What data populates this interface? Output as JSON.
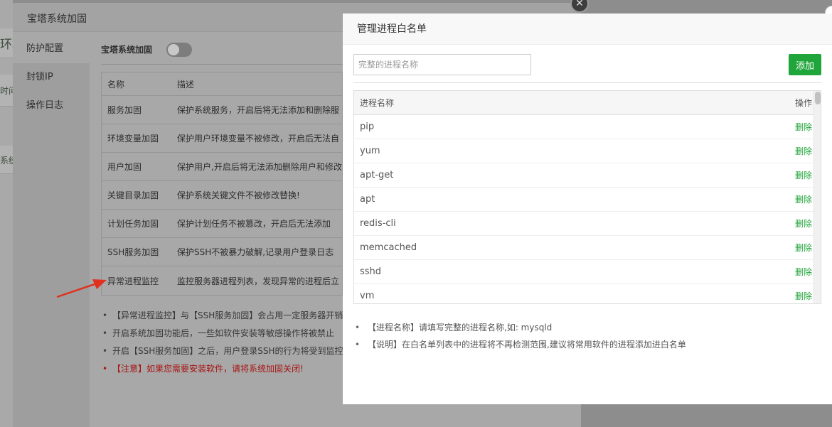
{
  "background_page": {
    "fragments": [
      "环境",
      "时间",
      "系统"
    ]
  },
  "back_dialog": {
    "title": "宝塔系统加固",
    "sidebar": [
      {
        "label": "防护配置",
        "active": true
      },
      {
        "label": "封锁IP",
        "active": false
      },
      {
        "label": "操作日志",
        "active": false
      }
    ],
    "toggle_label": "宝塔系统加固",
    "table": {
      "headers": [
        "名称",
        "描述"
      ],
      "rows": [
        {
          "name": "服务加固",
          "desc": "保护系统服务，开启后将无法添加和删除服"
        },
        {
          "name": "环境变量加固",
          "desc": "保护用户环境变量不被修改，开启后无法自"
        },
        {
          "name": "用户加固",
          "desc": "保护用户,开启后将无法添加删除用户和修改"
        },
        {
          "name": "关键目录加固",
          "desc": "保护系统关键文件不被修改替换!"
        },
        {
          "name": "计划任务加固",
          "desc": "保护计划任务不被篡改，开启后无法添加"
        },
        {
          "name": "SSH服务加固",
          "desc": "保护SSH不被暴力破解,记录用户登录日志"
        },
        {
          "name": "异常进程监控",
          "desc": "监控服务器进程列表，发现异常的进程后立"
        }
      ]
    },
    "notes": [
      {
        "text": "【异常进程监控】与【SSH服务加固】会占用一定服务器开销",
        "warn": false
      },
      {
        "text": "开启系统加固功能后，一些如软件安装等敏感操作将被禁止",
        "warn": false
      },
      {
        "text": "开启【SSH服务加固】之后，用户登录SSH的行为将受到监控",
        "warn": false
      },
      {
        "text": "【注意】如果您需要安装软件，请将系统加固关闭!",
        "warn": true
      }
    ]
  },
  "whitelist_dialog": {
    "title": "管理进程白名单",
    "input": {
      "value": "",
      "placeholder": "完整的进程名称"
    },
    "add_label": "添加",
    "table": {
      "headers": [
        "进程名称",
        "操作"
      ],
      "rows": [
        {
          "name": "pip",
          "action": "删除"
        },
        {
          "name": "yum",
          "action": "删除"
        },
        {
          "name": "apt-get",
          "action": "删除"
        },
        {
          "name": "apt",
          "action": "删除"
        },
        {
          "name": "redis-cli",
          "action": "删除"
        },
        {
          "name": "memcached",
          "action": "删除"
        },
        {
          "name": "sshd",
          "action": "删除"
        },
        {
          "name": "vm",
          "action": "删除"
        }
      ]
    },
    "notes": [
      "【进程名称】请填写完整的进程名称,如: mysqld",
      "【说明】在白名单列表中的进程将不再检测范围,建议将常用软件的进程添加进白名单"
    ]
  },
  "colors": {
    "accent_green": "#20a53a",
    "warning_red": "#a81212",
    "annotation_arrow": "#e0301e"
  },
  "icons": {
    "close": "close-icon",
    "arrow": "annotation-arrow"
  }
}
